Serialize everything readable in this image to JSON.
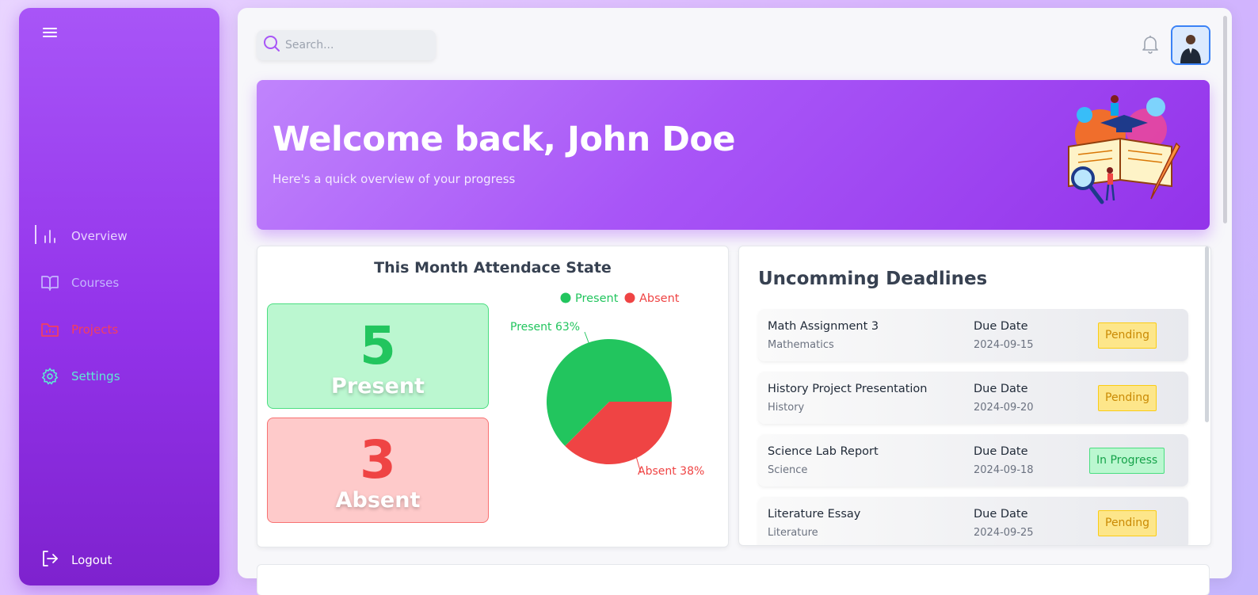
{
  "sidebar": {
    "menu_icon": "hamburger-icon",
    "items": [
      {
        "label": "Overview",
        "icon": "bar-chart-icon",
        "color": "#e9d5ff"
      },
      {
        "label": "Courses",
        "icon": "book-icon",
        "color": "#c4b5fd"
      },
      {
        "label": "Projects",
        "icon": "folder-icon",
        "color": "#f43f5e"
      },
      {
        "label": "Settings",
        "icon": "gear-icon",
        "color": "#5eead4"
      }
    ],
    "logout_label": "Logout"
  },
  "header": {
    "search_placeholder": "Search...",
    "notification_icon": "bell-icon"
  },
  "hero": {
    "title": "Welcome back, John Doe",
    "subtitle": "Here's a quick overview of your progress"
  },
  "attendance": {
    "title": "This Month Attendace State",
    "present_count": "5",
    "present_label": "Present",
    "absent_count": "3",
    "absent_label": "Absent",
    "legend_present": "Present",
    "legend_absent": "Absent",
    "pie_label_present": "Present 63%",
    "pie_label_absent": "Absent 38%",
    "colors": {
      "present": "#22c55e",
      "absent": "#ef4444"
    }
  },
  "chart_data": {
    "type": "pie",
    "categories": [
      "Present",
      "Absent"
    ],
    "values": [
      5,
      3
    ],
    "percent_labels": [
      "63%",
      "38%"
    ],
    "legend": "top"
  },
  "deadlines": {
    "title": "Uncomming Deadlines",
    "items": [
      {
        "name": "Math Assignment 3",
        "subject": "Mathematics",
        "due_label": "Due Date",
        "due_date": "2024-09-15",
        "status": "Pending"
      },
      {
        "name": "History Project Presentation",
        "subject": "History",
        "due_label": "Due Date",
        "due_date": "2024-09-20",
        "status": "Pending"
      },
      {
        "name": "Science Lab Report",
        "subject": "Science",
        "due_label": "Due Date",
        "due_date": "2024-09-18",
        "status": "In Progress"
      },
      {
        "name": "Literature Essay",
        "subject": "Literature",
        "due_label": "Due Date",
        "due_date": "2024-09-25",
        "status": "Pending"
      }
    ]
  }
}
